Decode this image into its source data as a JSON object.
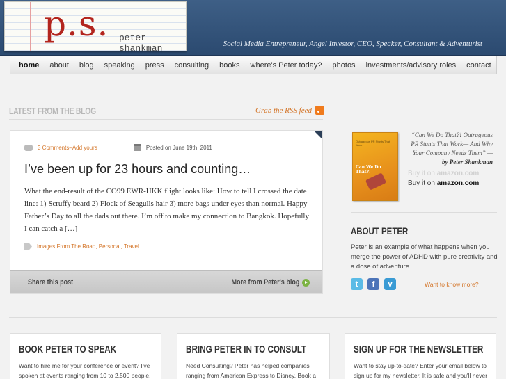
{
  "header": {
    "logo_mark": "p.s.",
    "logo_name": "peter shankman",
    "tagline": "Social Media Entrepreneur, Angel Investor, CEO, Speaker, Consultant & Adventurist"
  },
  "nav": {
    "items": [
      "home",
      "about",
      "blog",
      "speaking",
      "press",
      "consulting",
      "books",
      "where's Peter today?",
      "photos",
      "investments/advisory roles",
      "contact"
    ]
  },
  "blog": {
    "section_title": "LATEST FROM THE BLOG",
    "rss_label": "Grab the RSS feed",
    "post": {
      "comments": "3 Comments",
      "separator": " – ",
      "add_yours": "Add yours",
      "posted_on": "Posted on June 19th, 2011",
      "title": "I’ve been up for 23 hours and counting…",
      "excerpt": "What the end-result of the CO99 EWR-HKK flight looks like: How to tell I crossed the date line: 1) Scruffy beard 2) Flock of Seagulls hair 3) more bags under eyes than normal. Happy Father’s Day to all the dads out there. I’m off to make my connection to Bangkok. Hopefully I can catch a […]",
      "tags": [
        "Images From The Road",
        "Personal",
        "Travel"
      ]
    },
    "share_label": "Share this post",
    "more_label": "More from Peter's blog"
  },
  "sidebar": {
    "book_cover_text": "Outrageous PR Stunts That Work",
    "book_cover_title": "Can We Do That?!",
    "quote": "“Can We Do That?! Outrageous PR Stunts That Work— And Why Your Company Needs Them” —",
    "quote_by": "by Peter Shankman",
    "buy_ghost_prefix": "Buy it on",
    "buy_ghost_brand": "amazon.com",
    "buy_prefix": "Buy it on",
    "buy_brand": "amazon.com",
    "about_title": "ABOUT PETER",
    "about_text": "Peter is an example of what happens when you merge the power of ADHD with pure creativity and a dose of adventure.",
    "social": {
      "twitter": "t",
      "facebook": "f",
      "vimeo": "v"
    },
    "know_more": "Want to know more?"
  },
  "boxes": [
    {
      "title": "BOOK PETER TO SPEAK",
      "text": "Want to hire me for your conference or event? I've spoken at events ranging from 10 to 2,500 people."
    },
    {
      "title": "BRING PETER IN TO CONSULT",
      "text": "Need Consulting? Peter has helped companies ranging from American Express to Disney. Book a"
    },
    {
      "title": "SIGN UP FOR THE NEWSLETTER",
      "text": "Want to stay up-to-date? Enter your email below to sign up for my newsletter. It is safe and you'll never"
    }
  ]
}
